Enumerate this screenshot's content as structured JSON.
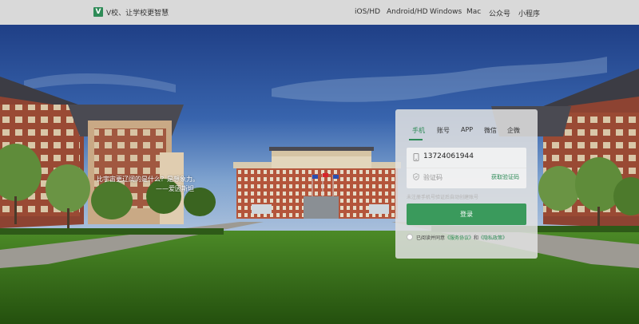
{
  "header": {
    "brand_letter": "V",
    "brand_text": "V校、让学校更智慧",
    "nav": [
      {
        "label": "iOS/HD"
      },
      {
        "label": "Android/HD"
      },
      {
        "label": "Windows"
      },
      {
        "label": "Mac"
      },
      {
        "label": "公众号"
      },
      {
        "label": "小程序"
      }
    ]
  },
  "hero": {
    "quote_line": "比宇宙更辽阔的是什么？是想象力。",
    "quote_author": "——爱因斯坦"
  },
  "login": {
    "tabs": [
      {
        "label": "手机",
        "active": true
      },
      {
        "label": "账号"
      },
      {
        "label": "APP"
      },
      {
        "label": "微信"
      },
      {
        "label": "企微"
      }
    ],
    "phone_value": "13724061944",
    "code_placeholder": "验证码",
    "get_code_label": "获取验证码",
    "hint": "未注册手机号验证后自动创建账号",
    "submit_label": "登录",
    "agree_prefix": "已阅读并同意",
    "service_link": "《服务协议》",
    "agree_and": "和",
    "privacy_link": "《隐私政策》",
    "accent_color": "#2e8b57"
  }
}
